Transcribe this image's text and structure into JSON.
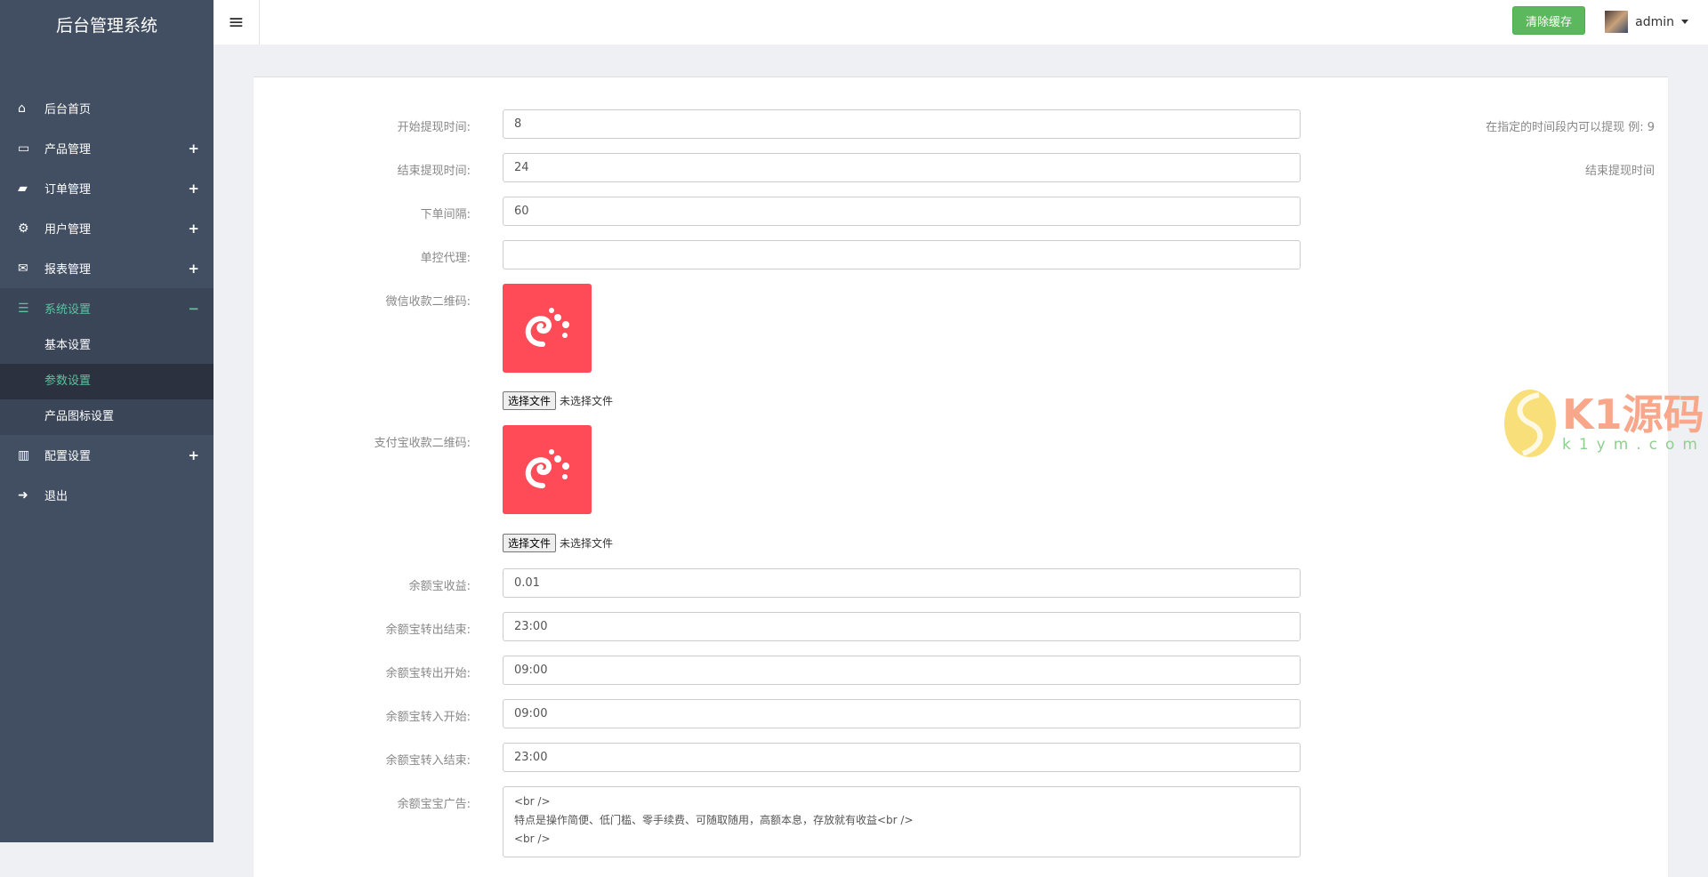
{
  "sidebar": {
    "brand": "后台管理系统",
    "items": [
      {
        "label": "后台首页",
        "icon": "home-icon"
      },
      {
        "label": "产品管理",
        "icon": "laptop-icon",
        "toggle": "+"
      },
      {
        "label": "订单管理",
        "icon": "book-icon",
        "toggle": "+"
      },
      {
        "label": "用户管理",
        "icon": "gears-icon",
        "toggle": "+"
      },
      {
        "label": "报表管理",
        "icon": "envelope-icon",
        "toggle": "+"
      },
      {
        "label": "系统设置",
        "icon": "tasks-icon",
        "toggle": "−"
      },
      {
        "label": "配置设置",
        "icon": "bar-chart-icon",
        "toggle": "+"
      },
      {
        "label": "退出",
        "icon": "sign-in-icon"
      }
    ],
    "sub": [
      "基本设置",
      "参数设置",
      "产品图标设置"
    ]
  },
  "header": {
    "clear_cache": "清除缓存",
    "user": "admin"
  },
  "form": {
    "start_label": "开始提现时间:",
    "start_value": "8",
    "start_help": "在指定的时间段内可以提现 例: 9",
    "end_label": "结束提现时间:",
    "end_value": "24",
    "end_help": "结束提现时间",
    "interval_label": "下单间隔:",
    "interval_value": "60",
    "agent_label": "单控代理:",
    "agent_value": "",
    "wechat_label": "微信收款二维码:",
    "alipay_label": "支付宝收款二维码:",
    "choose_file": "选择文件",
    "no_file": "未选择文件",
    "yeb_income_label": "余额宝收益:",
    "yeb_income_value": "0.01",
    "yeb_out_end_label": "余额宝转出结束:",
    "yeb_out_end_value": "23:00",
    "yeb_out_start_label": "余额宝转出开始:",
    "yeb_out_start_value": "09:00",
    "yeb_in_start_label": "余额宝转入开始:",
    "yeb_in_start_value": "09:00",
    "yeb_in_end_label": "余额宝转入结束:",
    "yeb_in_end_value": "23:00",
    "yeb_ad_label": "余额宝宝广告:",
    "yeb_ad_value": "<br />\n特点是操作简便、低门槛、零手续费、可随取随用，高额本息，存放就有收益<br />\n<br />"
  },
  "watermark": {
    "text": "K1源码",
    "url": "k1ym.com"
  },
  "colors": {
    "sidebar": "#424f63",
    "accent": "#5bc49f",
    "button": "#5cb85c",
    "qr": "#ff4a57"
  }
}
